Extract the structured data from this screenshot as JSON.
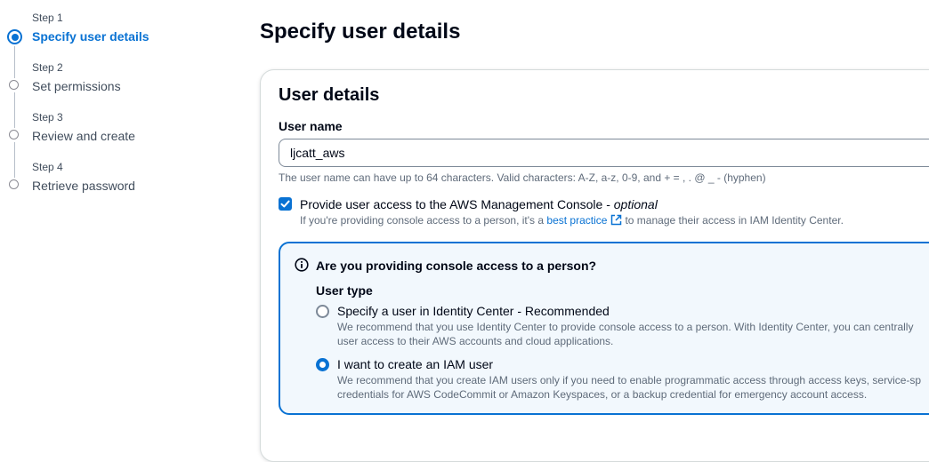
{
  "steps": [
    {
      "number": "Step 1",
      "title": "Specify user details"
    },
    {
      "number": "Step 2",
      "title": "Set permissions"
    },
    {
      "number": "Step 3",
      "title": "Review and create"
    },
    {
      "number": "Step 4",
      "title": "Retrieve password"
    }
  ],
  "page": {
    "title": "Specify user details"
  },
  "user_details": {
    "section_title": "User details",
    "user_name_label": "User name",
    "user_name_value": "ljcatt_aws",
    "user_name_constraint": "The user name can have up to 64 characters. Valid characters: A-Z, a-z, 0-9, and + = , . @ _ - (hyphen)"
  },
  "console_access": {
    "checked": true,
    "label": "Provide user access to the AWS Management Console - ",
    "optional": "optional",
    "desc_prefix": "If you're providing console access to a person, it's a ",
    "desc_link": "best practice",
    "desc_suffix": "to manage their access in IAM Identity Center."
  },
  "info_panel": {
    "title": "Are you providing console access to a person?",
    "user_type_label": "User type",
    "options": [
      {
        "label": "Specify a user in Identity Center - Recommended",
        "desc_line1": "We recommend that you use Identity Center to provide console access to a person. With Identity Center, you can centrally",
        "desc_line2": "user access to their AWS accounts and cloud applications.",
        "selected": false
      },
      {
        "label": "I want to create an IAM user",
        "desc_line1": "We recommend that you create IAM users only if you need to enable programmatic access through access keys, service-sp",
        "desc_line2": "credentials for AWS CodeCommit or Amazon Keyspaces, or a backup credential for emergency account access.",
        "selected": true
      }
    ]
  },
  "colors": {
    "accent": "#0972d3",
    "text": "#000716",
    "muted": "#5f6b7a",
    "panel_bg": "#f2f8fd"
  },
  "icons": [
    "checkmark-icon",
    "external-link-icon",
    "info-icon"
  ]
}
